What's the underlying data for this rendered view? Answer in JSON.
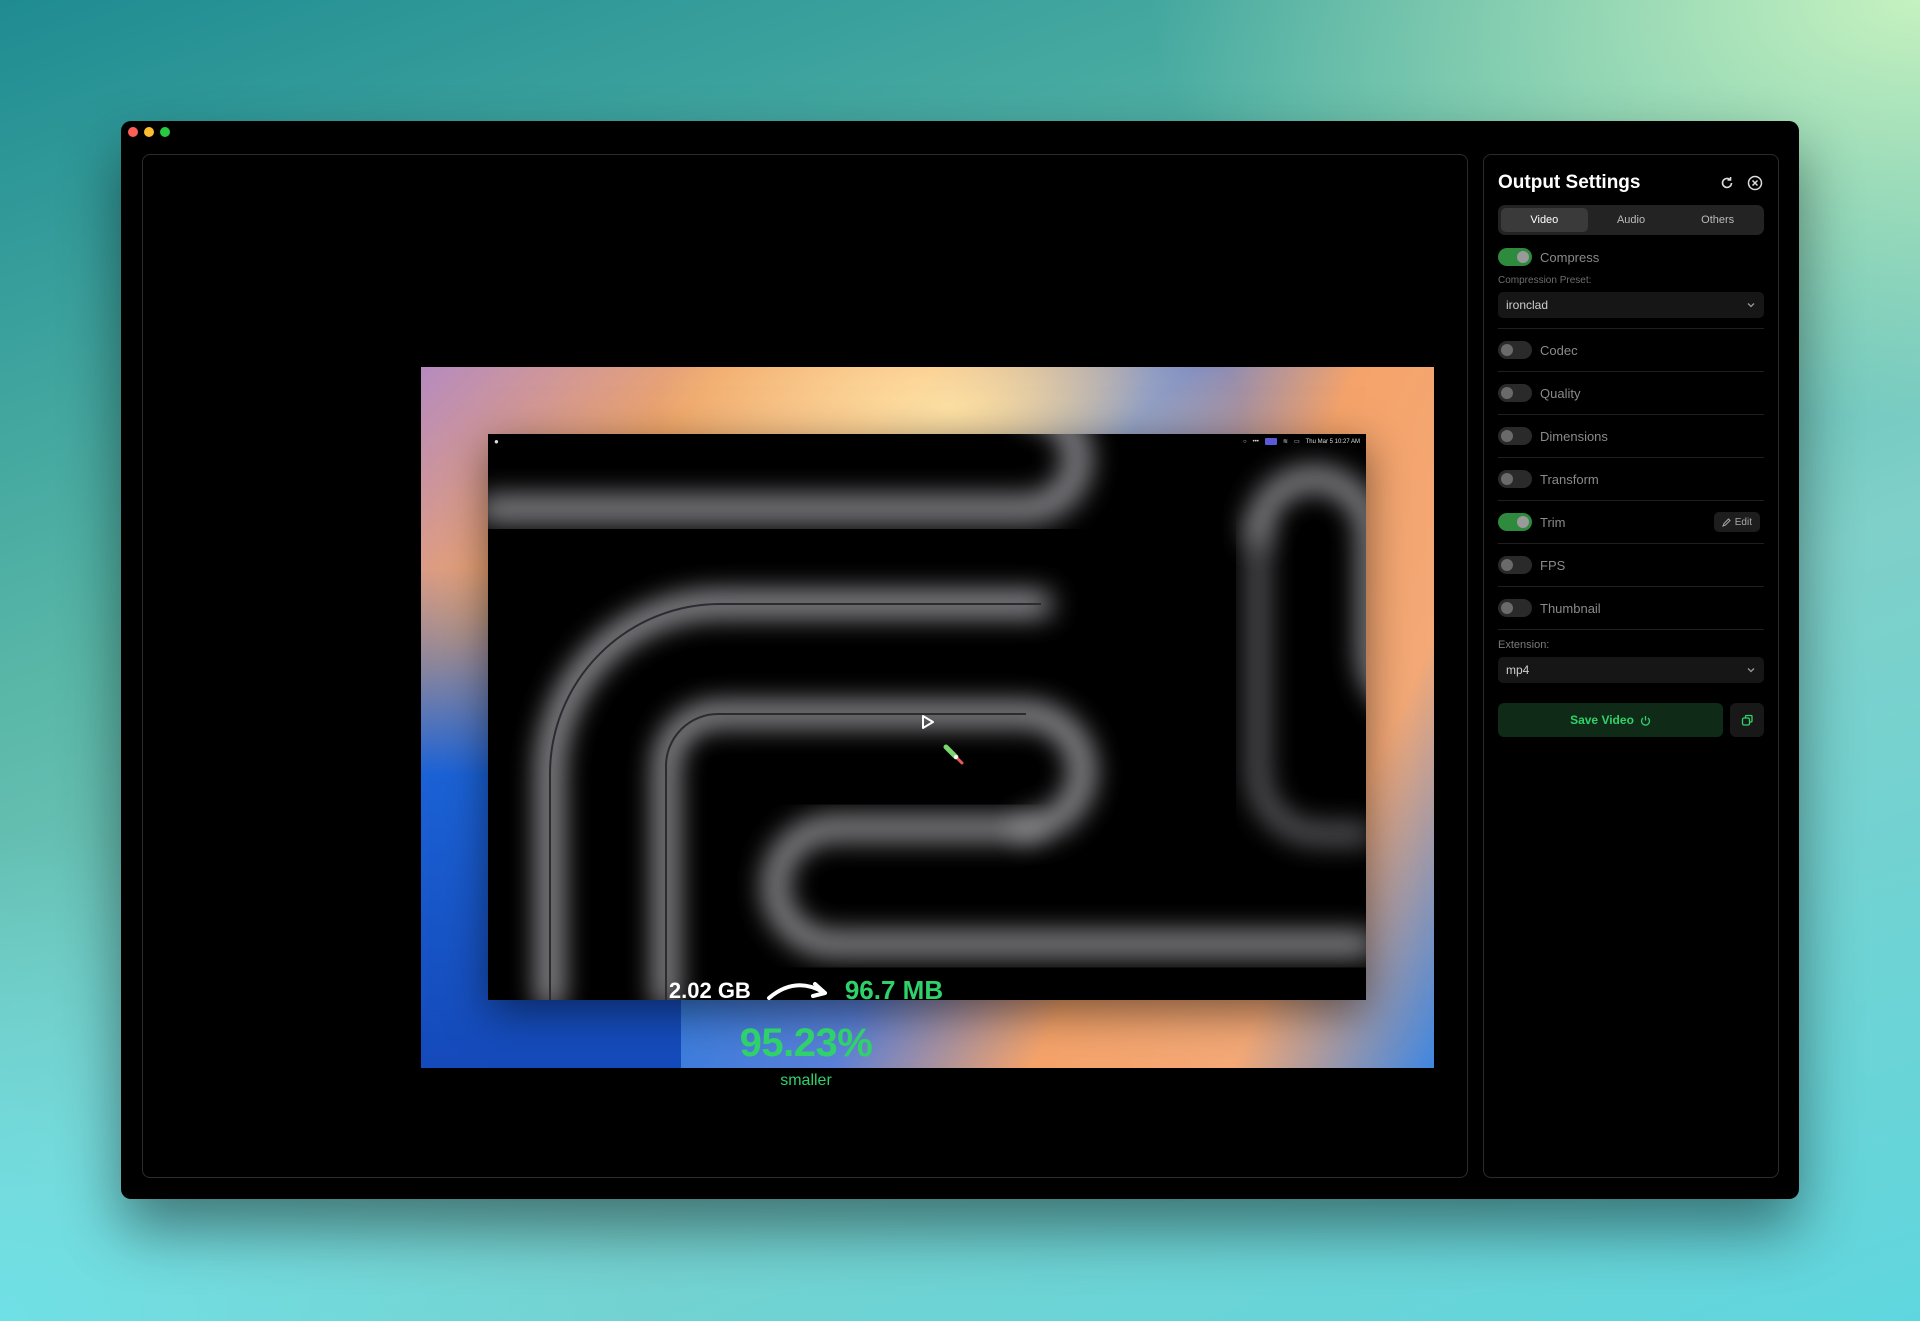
{
  "video_preview": {
    "menubar_clock": "Thu Mar 5  10:27 AM"
  },
  "stats": {
    "original_size": "2.02 GB",
    "compressed_size": "96.7 MB",
    "reduction_percent": "95.23%",
    "reduction_label": "smaller"
  },
  "settings": {
    "title": "Output Settings",
    "tabs": [
      {
        "label": "Video",
        "active": true
      },
      {
        "label": "Audio",
        "active": false
      },
      {
        "label": "Others",
        "active": false
      }
    ],
    "compress": {
      "label": "Compress",
      "enabled": true
    },
    "compression_preset": {
      "label": "Compression Preset:",
      "value": "ironclad"
    },
    "options": [
      {
        "label": "Codec",
        "enabled": false
      },
      {
        "label": "Quality",
        "enabled": false
      },
      {
        "label": "Dimensions",
        "enabled": false
      },
      {
        "label": "Transform",
        "enabled": false
      },
      {
        "label": "Trim",
        "enabled": true,
        "action": "Edit"
      },
      {
        "label": "FPS",
        "enabled": false
      },
      {
        "label": "Thumbnail",
        "enabled": false
      }
    ],
    "extension": {
      "label": "Extension:",
      "value": "mp4"
    },
    "save_button": "Save Video"
  },
  "colors": {
    "accent_green": "#2fd26a",
    "toggle_on": "#2e8b3d"
  }
}
